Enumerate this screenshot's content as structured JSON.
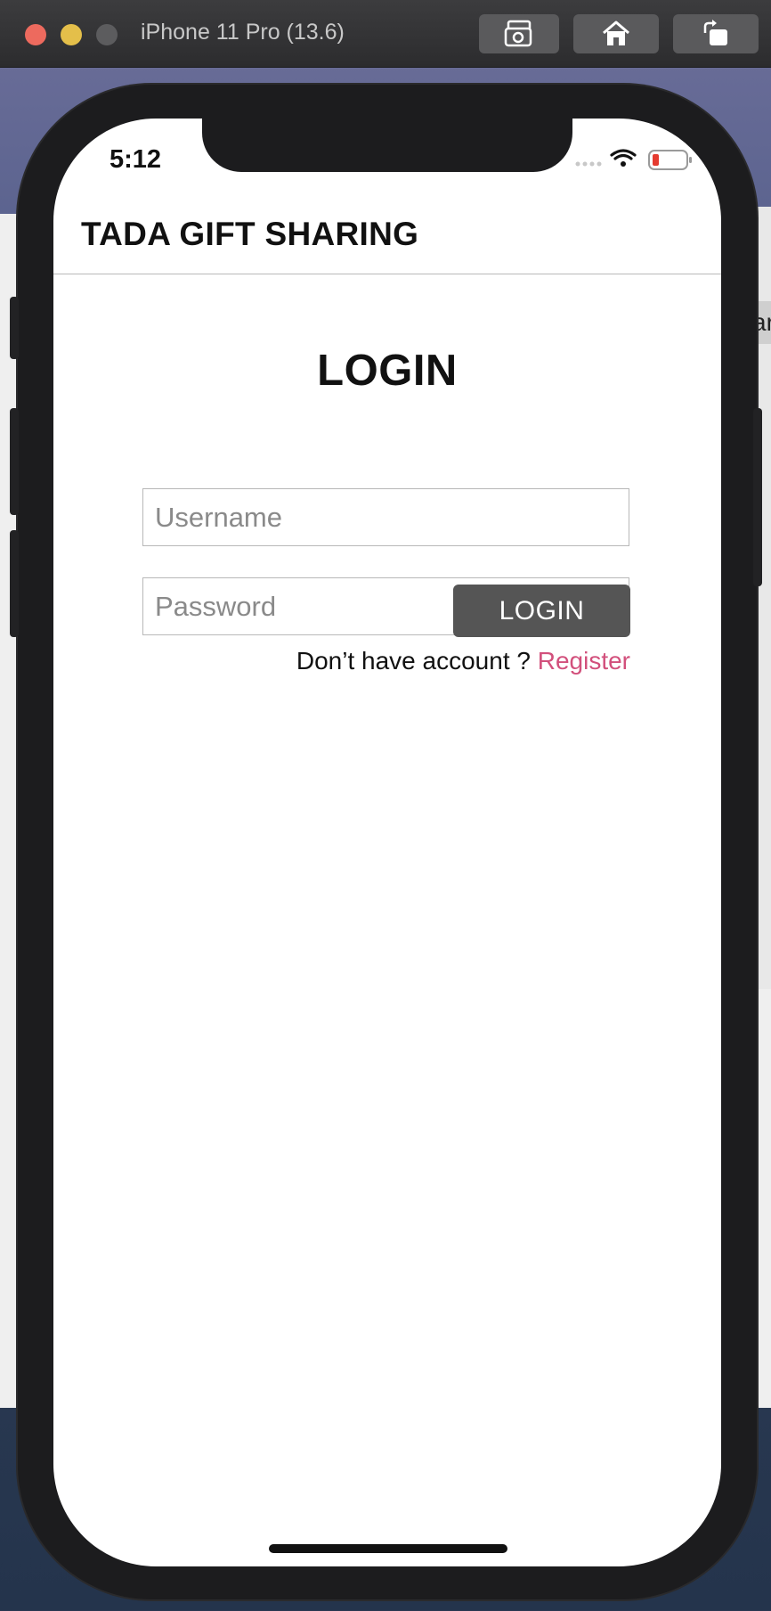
{
  "simulator": {
    "device_title": "iPhone 11 Pro (13.6)",
    "buttons": [
      "screenshot-icon",
      "home-icon",
      "rotate-icon"
    ]
  },
  "background_window": {
    "partial_text": "ar"
  },
  "status_bar": {
    "time": "5:12",
    "icons": [
      "signal-icon",
      "wifi-icon",
      "battery-low-icon"
    ],
    "battery_color": "#e53b30"
  },
  "app": {
    "title": "TADA GIFT SHARING"
  },
  "login": {
    "heading": "LOGIN",
    "username_placeholder": "Username",
    "password_placeholder": "Password",
    "button_label": "LOGIN",
    "register_prompt": "Don’t have account ?",
    "register_link": "Register",
    "link_color": "#d2507c",
    "button_color": "#555555"
  }
}
